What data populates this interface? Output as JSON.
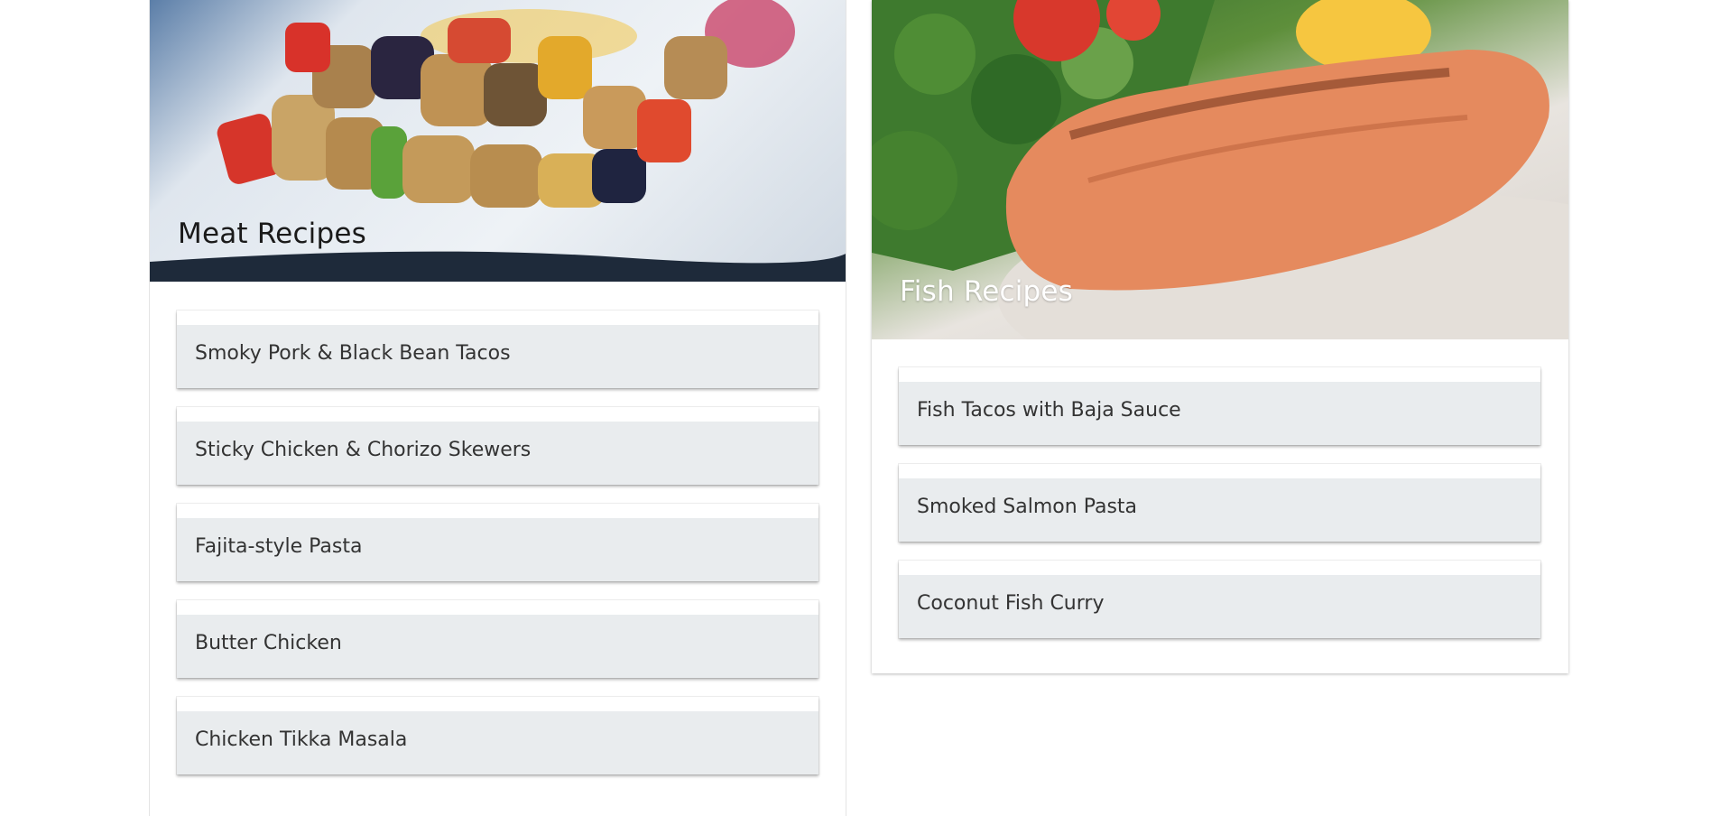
{
  "meat": {
    "title": "Meat Recipes",
    "items": [
      {
        "label": "Smoky Pork & Black Bean Tacos"
      },
      {
        "label": "Sticky Chicken & Chorizo Skewers"
      },
      {
        "label": "Fajita-style Pasta"
      },
      {
        "label": "Butter Chicken"
      },
      {
        "label": "Chicken Tikka Masala"
      }
    ]
  },
  "fish": {
    "title": "Fish Recipes",
    "items": [
      {
        "label": "Fish Tacos with Baja Sauce"
      },
      {
        "label": "Smoked Salmon Pasta"
      },
      {
        "label": "Coconut Fish Curry"
      }
    ]
  }
}
